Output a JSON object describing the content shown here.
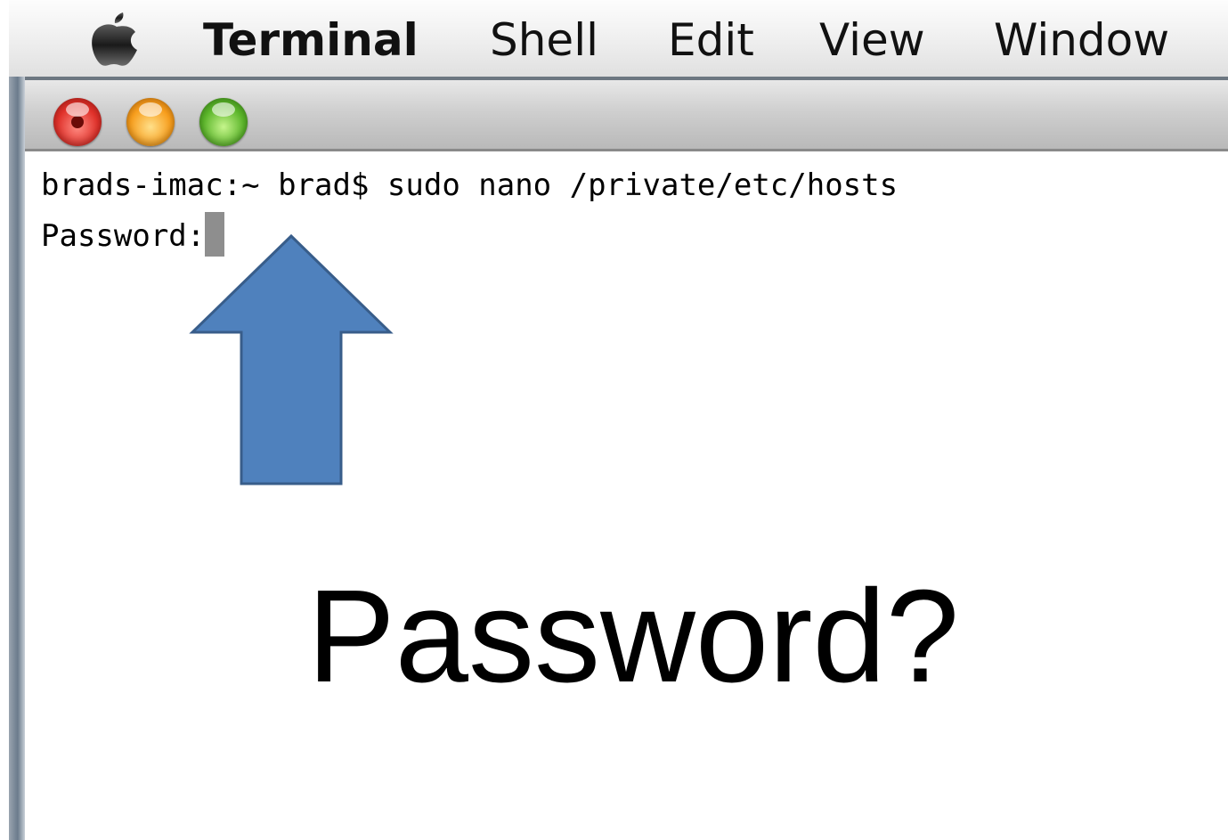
{
  "menubar": {
    "apple_icon": "apple-logo-icon",
    "items": [
      "Terminal",
      "Shell",
      "Edit",
      "View",
      "Window"
    ]
  },
  "window": {
    "traffic_lights": [
      "close",
      "minimize",
      "zoom"
    ]
  },
  "terminal": {
    "command_line": "brads-imac:~ brad$ sudo nano /private/etc/hosts",
    "prompt": "Password:"
  },
  "annotation": {
    "arrow_icon": "up-arrow-icon",
    "arrow_color": "#4f81bd",
    "label": "Password?"
  }
}
